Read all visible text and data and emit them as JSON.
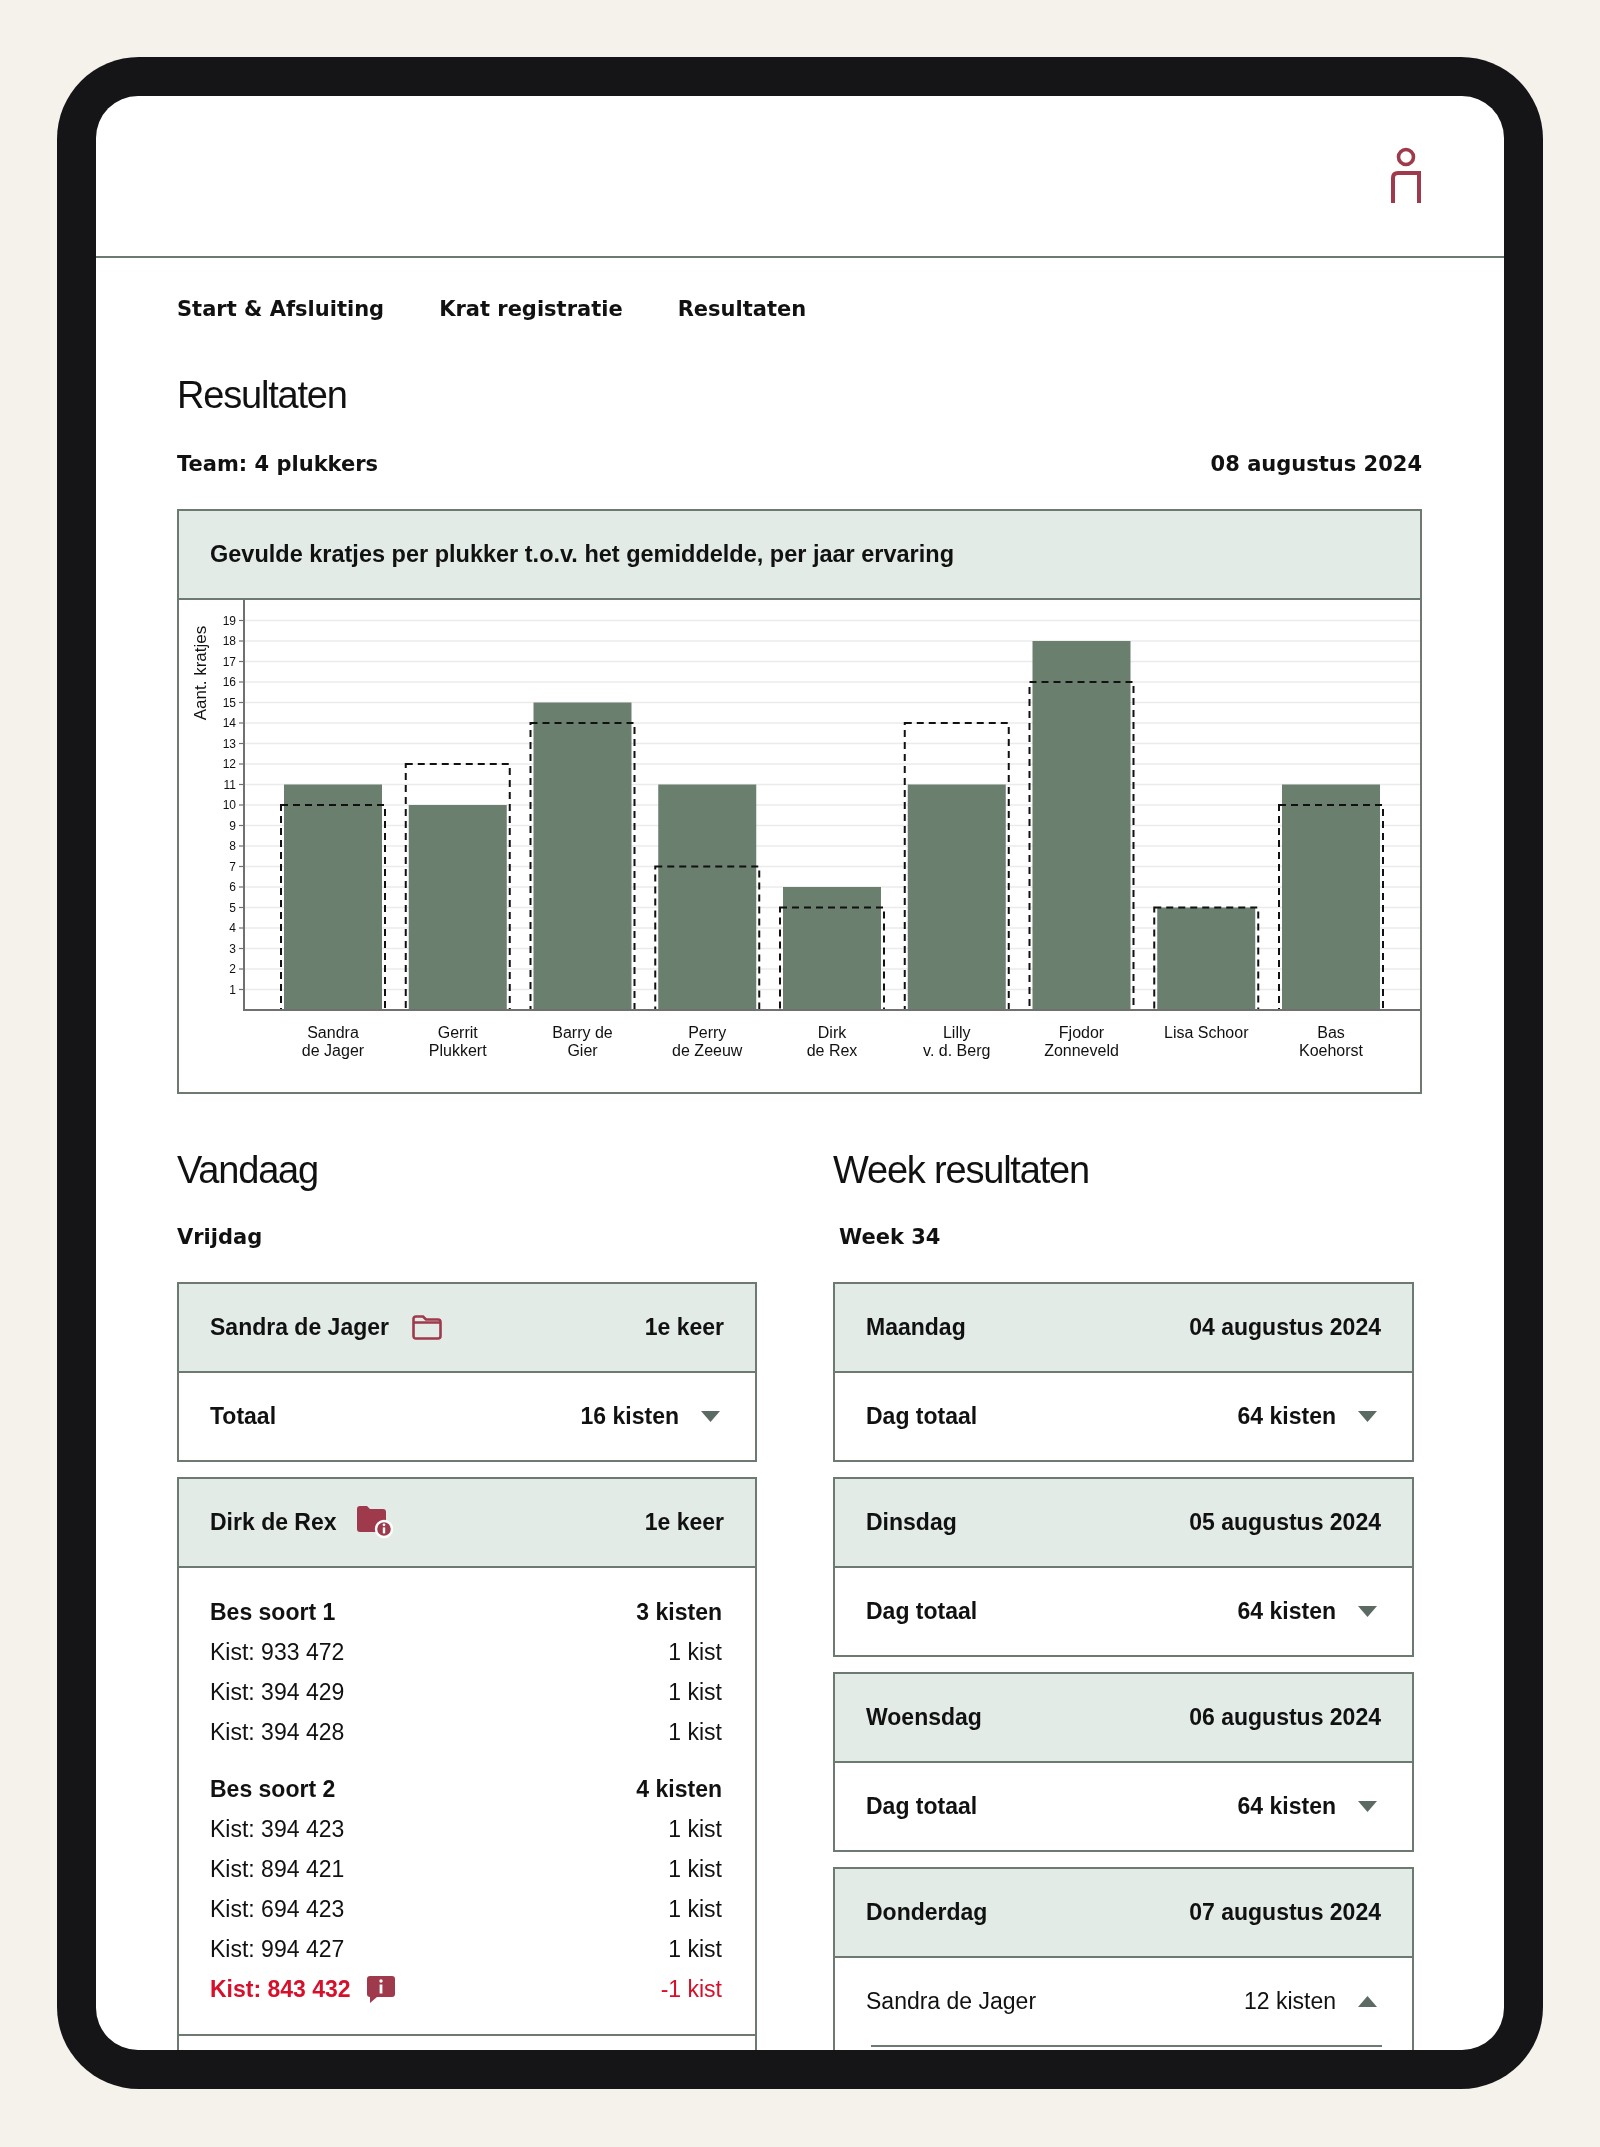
{
  "nav": [
    {
      "label": "Start & Afsluiting"
    },
    {
      "label": "Krat registratie"
    },
    {
      "label": "Resultaten"
    }
  ],
  "page_title": "Resultaten",
  "team": "Team: 4 plukkers",
  "date": "08 augustus 2024",
  "chart": {
    "chart_data": {
      "type": "bar",
      "title": "Gevulde kratjes per plukker t.o.v. het gemiddelde, per jaar ervaring",
      "ylabel": "Aant. kratjes",
      "categories": [
        "Sandra\nde Jager",
        "Gerrit\nPlukkert",
        "Barry de\nGier",
        "Perry\nde Zeeuw",
        "Dirk\nde Rex",
        "Lilly\nv. d. Berg",
        "Fjodor\nZonneveld",
        "Lisa Schoor",
        "Bas\nKoehorst"
      ],
      "series": [
        {
          "color": "#6b7f6f",
          "values": [
            11,
            10,
            15,
            11,
            6,
            11,
            18,
            5,
            11
          ]
        },
        {
          "color": "#111111",
          "values": [
            10,
            12,
            14,
            7,
            5,
            14,
            16,
            5,
            10
          ]
        }
      ],
      "ylim": [
        0,
        20
      ],
      "yticks": [
        1,
        2,
        3,
        4,
        5,
        6,
        7,
        8,
        9,
        10,
        11,
        12,
        13,
        14,
        15,
        16,
        17,
        18,
        19
      ],
      "grid": true
    }
  },
  "today": {
    "title": "Vandaag",
    "day": "Vrijdag",
    "pickers": [
      {
        "name": "Sandra de Jager",
        "has_note": false,
        "visit": "1e keer",
        "rows": [
          {
            "kind": "total",
            "label": "Totaal",
            "count": "16 kisten",
            "expanded": false
          }
        ]
      },
      {
        "name": "Dirk de Rex",
        "has_note": true,
        "visit": "1e keer",
        "groups": [
          {
            "label": "Bes soort 1",
            "count": "3 kisten",
            "crates": [
              {
                "label": "Kist: 933 472",
                "count": "1 kist",
                "error": false
              },
              {
                "label": "Kist: 394 429",
                "count": "1 kist",
                "error": false
              },
              {
                "label": "Kist: 394 428",
                "count": "1 kist",
                "error": false
              }
            ]
          },
          {
            "label": "Bes soort 2",
            "count": "4 kisten",
            "crates": [
              {
                "label": "Kist: 394 423",
                "count": "1 kist",
                "error": false
              },
              {
                "label": "Kist: 894 421",
                "count": "1 kist",
                "error": false
              },
              {
                "label": "Kist: 694 423",
                "count": "1 kist",
                "error": false
              },
              {
                "label": "Kist: 994 427",
                "count": "1 kist",
                "error": false
              },
              {
                "label": "Kist: 843 432",
                "count": "-1 kist",
                "error": true
              }
            ]
          }
        ]
      }
    ]
  },
  "week": {
    "title": "Week resultaten",
    "week": "Week 34",
    "days": [
      {
        "day": "Maandag",
        "date": "04 augustus 2024",
        "rows": [
          {
            "kind": "total",
            "label": "Dag totaal",
            "count": "64 kisten",
            "expanded": false
          }
        ]
      },
      {
        "day": "Dinsdag",
        "date": "05 augustus 2024",
        "rows": [
          {
            "kind": "total",
            "label": "Dag totaal",
            "count": "64 kisten",
            "expanded": false
          }
        ]
      },
      {
        "day": "Woensdag",
        "date": "06 augustus 2024",
        "rows": [
          {
            "kind": "total",
            "label": "Dag totaal",
            "count": "64 kisten",
            "expanded": false
          }
        ]
      },
      {
        "day": "Donderdag",
        "date": "07 augustus 2024",
        "rows": [
          {
            "kind": "picker",
            "label": "Sandra de Jager",
            "count": "12 kisten",
            "expanded": true
          }
        ]
      }
    ]
  }
}
